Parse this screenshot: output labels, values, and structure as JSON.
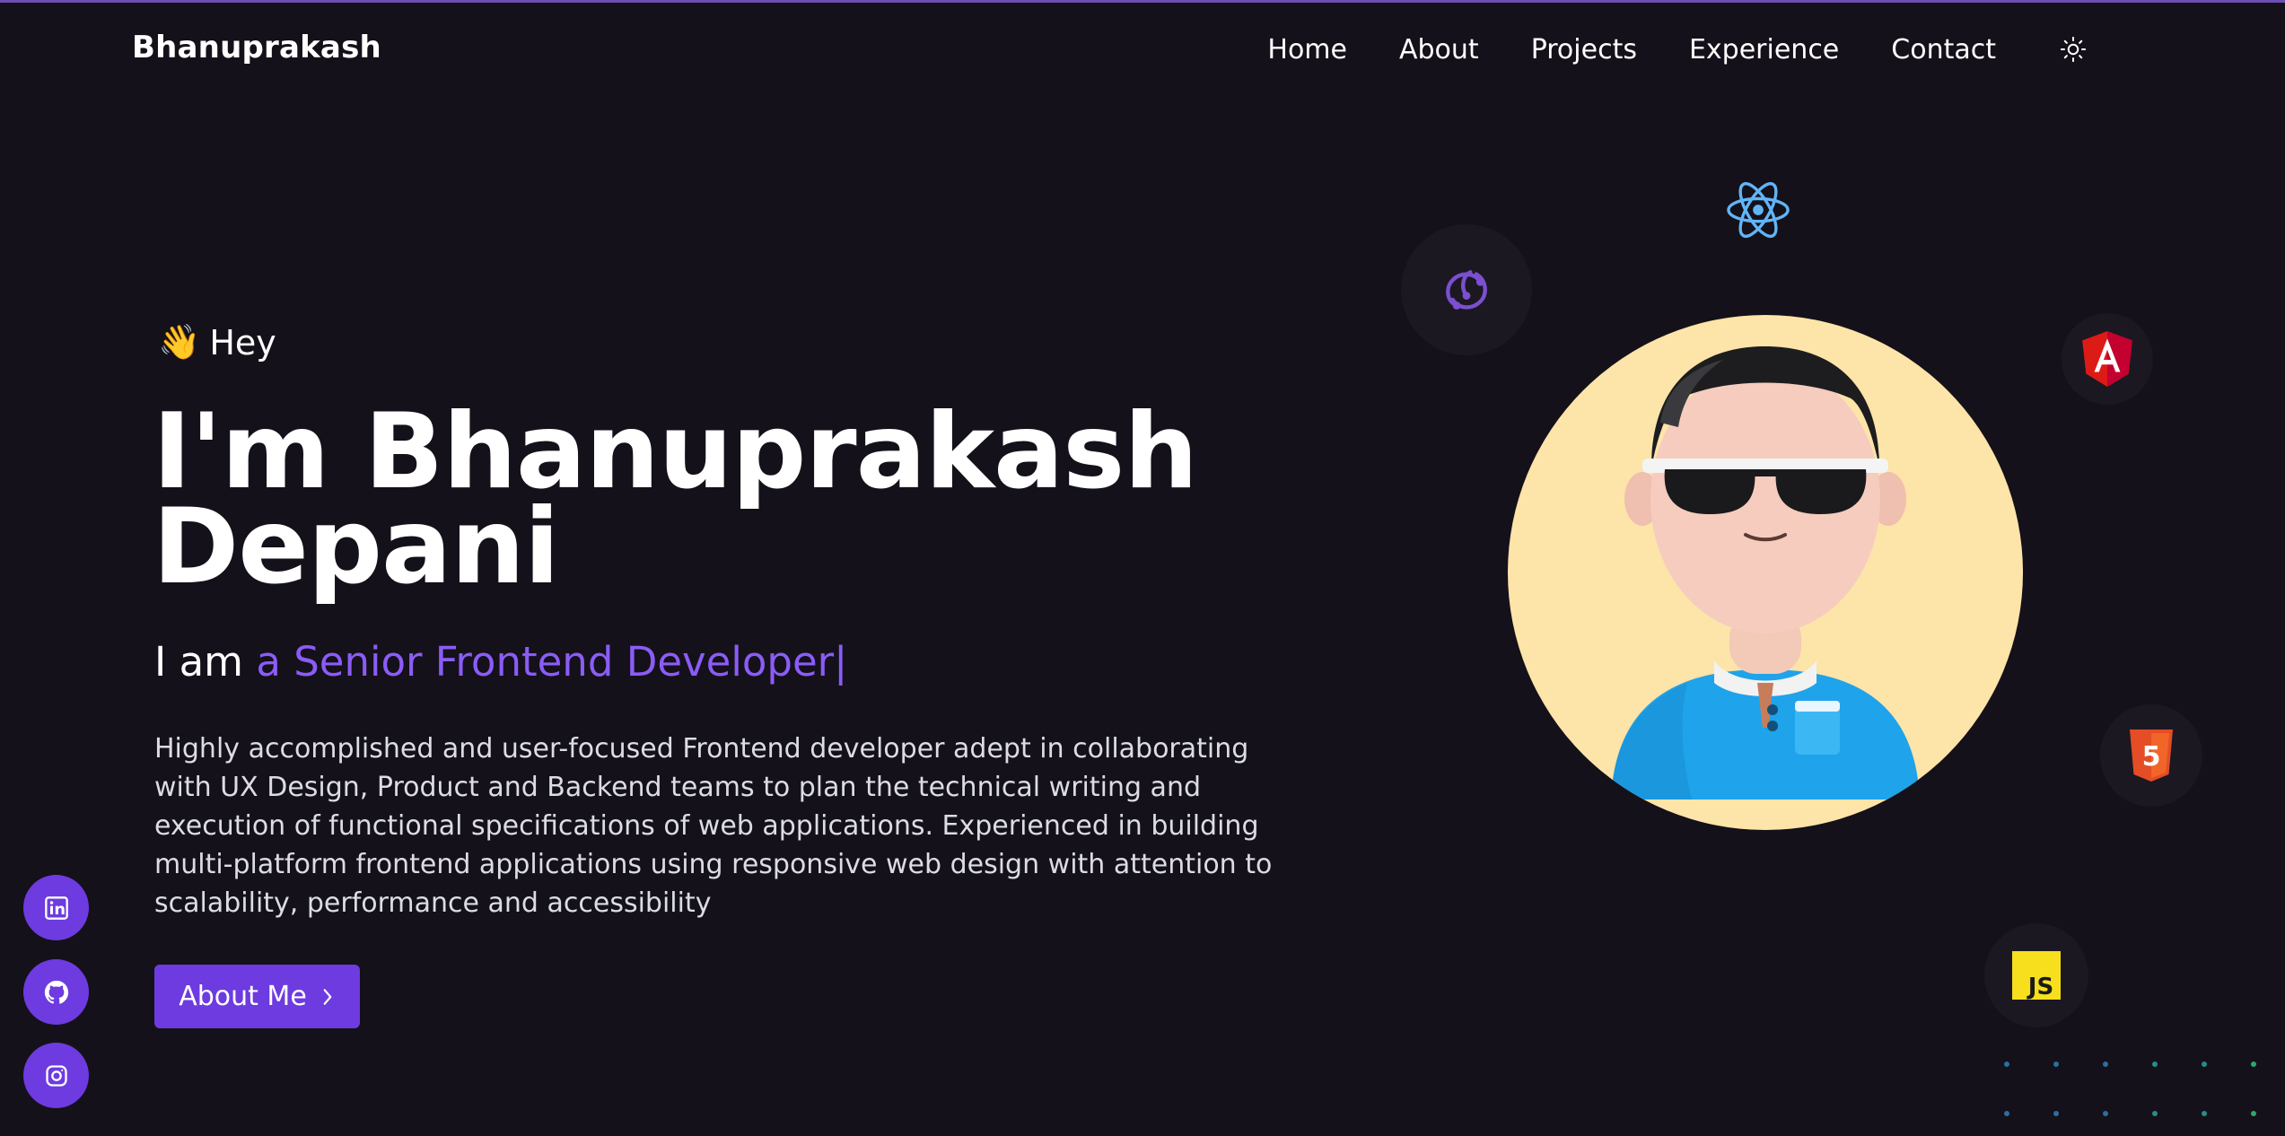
{
  "brand": {
    "name": "Bhanuprakash"
  },
  "nav": {
    "items": [
      {
        "label": "Home"
      },
      {
        "label": "About"
      },
      {
        "label": "Projects"
      },
      {
        "label": "Experience"
      },
      {
        "label": "Contact"
      }
    ],
    "theme_icon": "sun-icon"
  },
  "hero": {
    "greeting_emoji": "👋",
    "greeting": "Hey",
    "title_line1": "I'm Bhanuprakash",
    "title_line2": "Depani",
    "role_prefix": "I am",
    "role_highlight": "a Senior Frontend Developer",
    "caret": "|",
    "description": "Highly accomplished and user-focused Frontend developer adept in collaborating with UX Design, Product and Backend teams to plan the technical writing and execution of functional specifications of web applications. Experienced in building multi-platform frontend applications using responsive web design with attention to scalability, performance and accessibility",
    "cta_label": "About Me"
  },
  "social": [
    {
      "icon": "linkedin-icon"
    },
    {
      "icon": "github-icon"
    },
    {
      "icon": "instagram-icon"
    }
  ],
  "tech_icons": [
    {
      "icon": "redux-icon"
    },
    {
      "icon": "react-icon"
    },
    {
      "icon": "angular-icon"
    },
    {
      "icon": "html5-icon",
      "text": "5"
    },
    {
      "icon": "javascript-icon",
      "text": "JS"
    }
  ],
  "colors": {
    "background": "#14111a",
    "accent": "#6d3be0",
    "accent_text": "#8b5cf6",
    "avatar_bg": "#fde4a8"
  }
}
